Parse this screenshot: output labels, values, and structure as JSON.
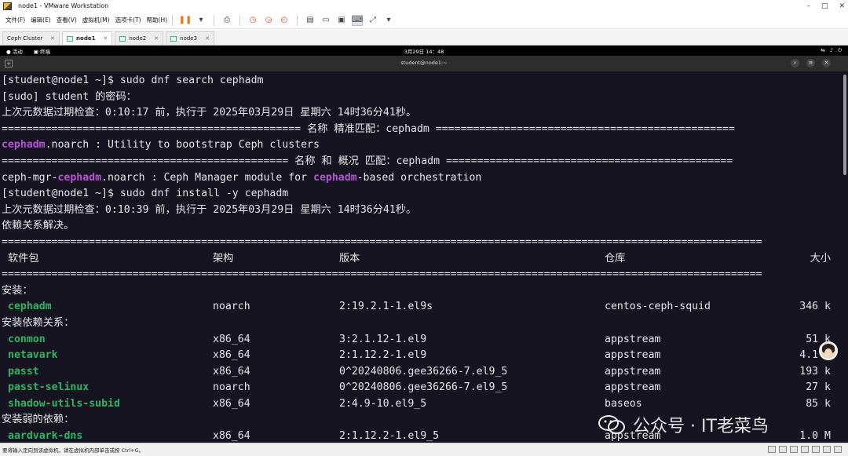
{
  "window": {
    "title": "node1 - VMware Workstation",
    "controls": [
      "–",
      "□",
      "✕"
    ]
  },
  "menu": [
    "文件(F)",
    "编辑(E)",
    "查看(V)",
    "虚拟机(M)",
    "选项卡(T)",
    "帮助(H)"
  ],
  "tabs": [
    {
      "label": "Ceph Cluster",
      "active": false
    },
    {
      "label": "node1",
      "active": true
    },
    {
      "label": "node2",
      "active": false
    },
    {
      "label": "node3",
      "active": false
    }
  ],
  "gnome": {
    "activities": "活动",
    "terminal": "终端",
    "clock": "3月29日 14：48"
  },
  "terminal_title": "student@node1:~",
  "terminal": {
    "lines": [
      [
        {
          "t": "[student@node1 ~]$ sudo dnf search cephadm"
        }
      ],
      [
        {
          "t": "[sudo] student 的密码："
        }
      ],
      [
        {
          "t": "上次元数据过期检查：0:10:17 前，执行于 2025年03月29日 星期六 14时36分41秒。"
        }
      ],
      [
        {
          "t": "================================================ 名称 精准匹配：cephadm ================================================"
        }
      ],
      [
        {
          "t": "cephadm",
          "s": "hl"
        },
        {
          "t": ".noarch : Utility to bootstrap Ceph clusters"
        }
      ],
      [
        {
          "t": "============================================== 名称 和 概况 匹配：cephadm =============================================="
        }
      ],
      [
        {
          "t": "ceph-mgr-"
        },
        {
          "t": "cephadm",
          "s": "hl"
        },
        {
          "t": ".noarch : Ceph Manager module for "
        },
        {
          "t": "cephadm",
          "s": "hl"
        },
        {
          "t": "-based orchestration"
        }
      ],
      [
        {
          "t": "[student@node1 ~]$ sudo dnf install -y cephadm"
        }
      ],
      [
        {
          "t": "上次元数据过期检查：0:10:39 前，执行于 2025年03月29日 星期六 14时36分41秒。"
        }
      ],
      [
        {
          "t": "依赖关系解决。"
        }
      ],
      [
        {
          "t": "=========================================================================================================================="
        }
      ]
    ],
    "headers": [
      "软件包",
      "架构",
      "版本",
      "仓库",
      "大小"
    ],
    "separator": "==========================================================================================================================",
    "groups": [
      {
        "title": "安装：",
        "rows": [
          {
            "pkg": "cephadm",
            "arch": "noarch",
            "ver": "2:19.2.1-1.el9s",
            "repo": "centos-ceph-squid",
            "size": "346 k"
          }
        ]
      },
      {
        "title": "安装依赖关系：",
        "rows": [
          {
            "pkg": "conmon",
            "arch": "x86_64",
            "ver": "3:2.1.12-1.el9",
            "repo": "appstream",
            "size": "51 k"
          },
          {
            "pkg": "netavark",
            "arch": "x86_64",
            "ver": "2:1.12.2-1.el9",
            "repo": "appstream",
            "size": "4.1 M"
          },
          {
            "pkg": "passt",
            "arch": "x86_64",
            "ver": "0^20240806.gee36266-7.el9_5",
            "repo": "appstream",
            "size": "193 k"
          },
          {
            "pkg": "passt-selinux",
            "arch": "noarch",
            "ver": "0^20240806.gee36266-7.el9_5",
            "repo": "appstream",
            "size": "27 k"
          },
          {
            "pkg": "shadow-utils-subid",
            "arch": "x86_64",
            "ver": "2:4.9-10.el9_5",
            "repo": "baseos",
            "size": "85 k"
          }
        ]
      },
      {
        "title": "安装弱的依赖：",
        "rows": [
          {
            "pkg": "aardvark-dns",
            "arch": "x86_64",
            "ver": "2:1.12.2-1.el9_5",
            "repo": "appstream",
            "size": "1.0 M"
          }
        ]
      }
    ]
  },
  "status": {
    "text": "要将输入定向到该虚拟机，请在虚拟机内部单击或按 Ctrl+G。"
  },
  "watermark": "公众号 · IT老菜鸟",
  "colors": {
    "terminal_bg": "#171421",
    "match_highlight": "#b554d4",
    "package_green": "#2fb463"
  }
}
